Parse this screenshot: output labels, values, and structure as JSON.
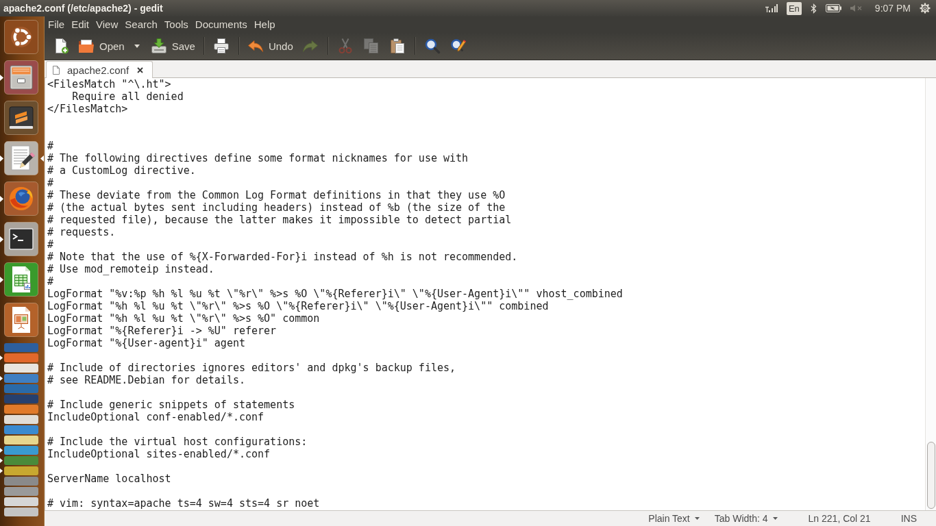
{
  "top_panel": {
    "title": "apache2.conf (/etc/apache2) - gedit",
    "keyboard_layout": "En",
    "clock": "9:07 PM"
  },
  "launcher": {
    "items": [
      {
        "kind": "ubuntu",
        "running": false,
        "selected": false
      },
      {
        "kind": "files",
        "running": true,
        "selected": false
      },
      {
        "kind": "sublime",
        "running": false,
        "selected": false
      },
      {
        "kind": "editor",
        "running": true,
        "selected": true
      },
      {
        "kind": "firefox",
        "running": true,
        "selected": false
      },
      {
        "kind": "terminal",
        "running": true,
        "selected": false
      },
      {
        "kind": "calc",
        "running": true,
        "selected": false
      },
      {
        "kind": "impress",
        "running": false,
        "selected": false
      }
    ],
    "stack": [
      {
        "color": "#2d5f9e",
        "running": false
      },
      {
        "color": "#e2682b",
        "running": true
      },
      {
        "color": "#e9e5de",
        "running": false
      },
      {
        "color": "#3f7fc2",
        "running": true
      },
      {
        "color": "#2a6aa8",
        "running": false
      },
      {
        "color": "#26406e",
        "running": false
      },
      {
        "color": "#e07a2a",
        "running": false
      },
      {
        "color": "#e2ddd6",
        "running": false
      },
      {
        "color": "#3a8ad0",
        "running": false
      },
      {
        "color": "#e6d68e",
        "running": false
      },
      {
        "color": "#3a9ad0",
        "running": true
      },
      {
        "color": "#4a8a3a",
        "running": true
      },
      {
        "color": "#c8a830",
        "running": true
      },
      {
        "color": "#8a8a8a",
        "running": false
      },
      {
        "color": "#9a9a9a",
        "running": false
      },
      {
        "color": "#d6d6d6",
        "running": false
      },
      {
        "color": "#c4c4c4",
        "running": false
      }
    ]
  },
  "menu_bar": [
    "File",
    "Edit",
    "View",
    "Search",
    "Tools",
    "Documents",
    "Help"
  ],
  "toolbar": {
    "groups": [
      [
        {
          "kind": "new",
          "disabled": false
        },
        {
          "kind": "open",
          "label": "Open",
          "disabled": false
        },
        {
          "kind": "open-menu",
          "disabled": false
        },
        {
          "kind": "save",
          "label": "Save",
          "disabled": false
        }
      ],
      [
        {
          "kind": "print",
          "disabled": false
        }
      ],
      [
        {
          "kind": "undo",
          "label": "Undo",
          "disabled": false
        },
        {
          "kind": "redo",
          "disabled": true
        }
      ],
      [
        {
          "kind": "cut",
          "disabled": true
        },
        {
          "kind": "copy",
          "disabled": true
        },
        {
          "kind": "paste",
          "disabled": false
        }
      ],
      [
        {
          "kind": "find",
          "disabled": false
        },
        {
          "kind": "replace",
          "disabled": false
        }
      ]
    ]
  },
  "tabs": [
    {
      "label": "apache2.conf",
      "selected": true
    }
  ],
  "editor": {
    "text": "<FilesMatch \"^\\.ht\">\n    Require all denied\n</FilesMatch>\n\n\n#\n# The following directives define some format nicknames for use with\n# a CustomLog directive.\n#\n# These deviate from the Common Log Format definitions in that they use %O\n# (the actual bytes sent including headers) instead of %b (the size of the\n# requested file), because the latter makes it impossible to detect partial\n# requests.\n#\n# Note that the use of %{X-Forwarded-For}i instead of %h is not recommended.\n# Use mod_remoteip instead.\n#\nLogFormat \"%v:%p %h %l %u %t \\\"%r\\\" %>s %O \\\"%{Referer}i\\\" \\\"%{User-Agent}i\\\"\" vhost_combined\nLogFormat \"%h %l %u %t \\\"%r\\\" %>s %O \\\"%{Referer}i\\\" \\\"%{User-Agent}i\\\"\" combined\nLogFormat \"%h %l %u %t \\\"%r\\\" %>s %O\" common\nLogFormat \"%{Referer}i -> %U\" referer\nLogFormat \"%{User-agent}i\" agent\n\n# Include of directories ignores editors' and dpkg's backup files,\n# see README.Debian for details.\n\n# Include generic snippets of statements\nIncludeOptional conf-enabled/*.conf\n\n# Include the virtual host configurations:\nIncludeOptional sites-enabled/*.conf\n\nServerName localhost\n\n# vim: syntax=apache ts=4 sw=4 sts=4 sr noet"
  },
  "status_bar": [
    {
      "kind": "dropdown",
      "label": "Plain Text"
    },
    {
      "kind": "dropdown",
      "label": "Tab Width: 4"
    },
    {
      "kind": "text",
      "label": "Ln 221, Col 21"
    },
    {
      "kind": "text",
      "label": "INS"
    }
  ]
}
